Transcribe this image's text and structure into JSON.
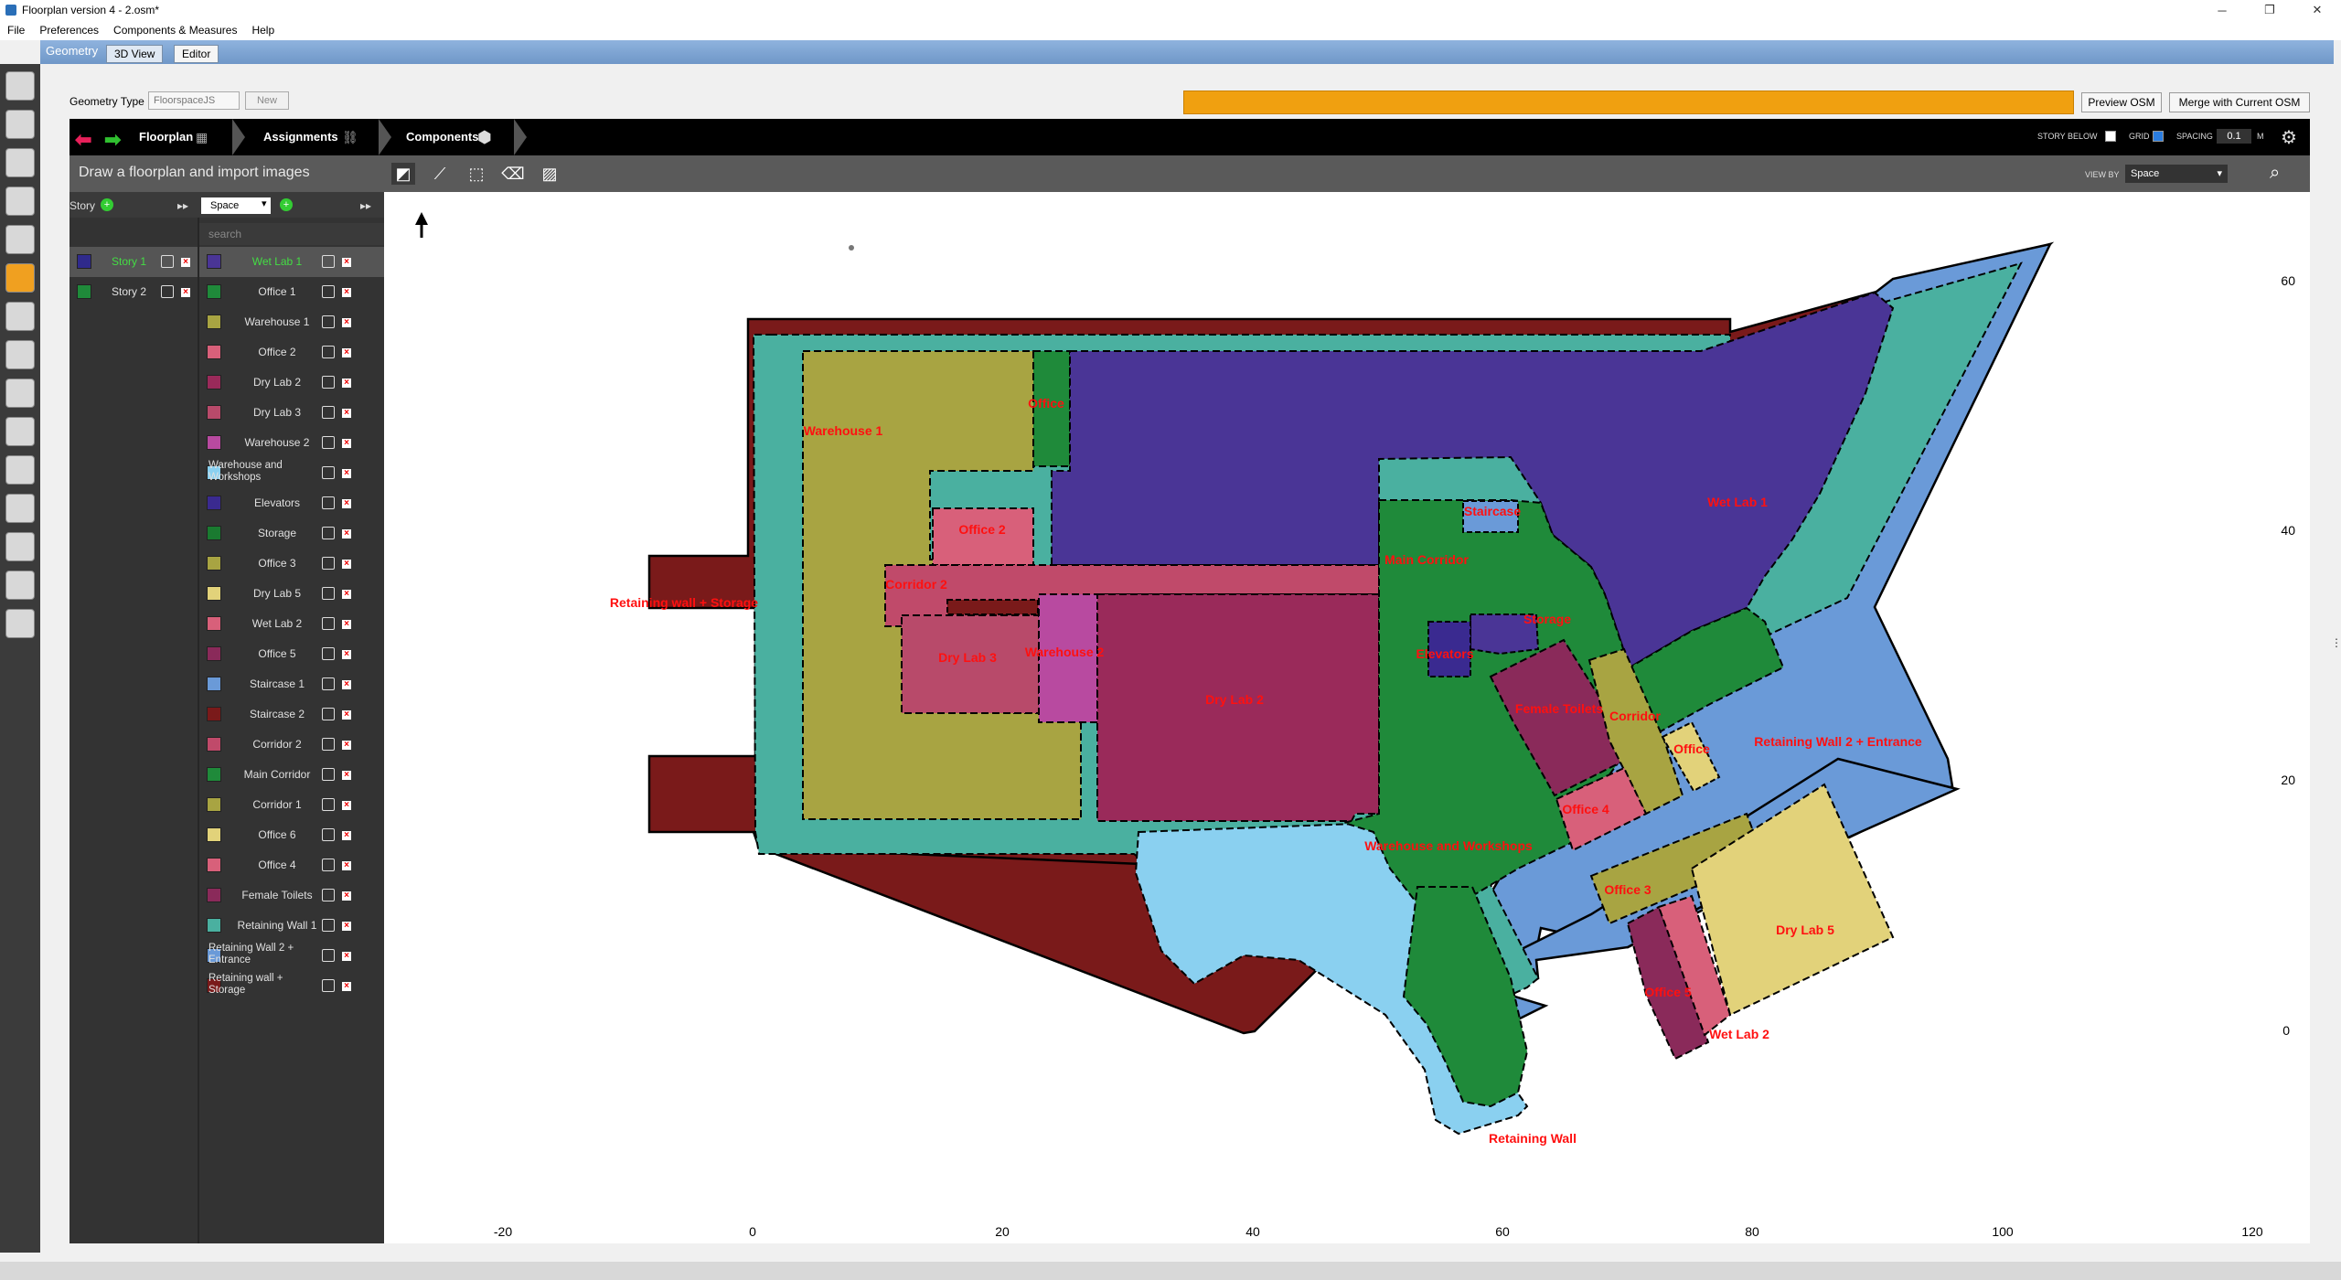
{
  "window": {
    "title": "Floorplan version 4 - 2.osm*",
    "min": "─",
    "max": "❐",
    "close": "✕"
  },
  "menu": [
    "File",
    "Preferences",
    "Components & Measures",
    "Help"
  ],
  "tabs": {
    "group": "Geometry",
    "view3d": "3D View",
    "editor": "Editor"
  },
  "geometry_type": {
    "label": "Geometry Type",
    "value": "FloorspaceJS",
    "new": "New"
  },
  "buttons": {
    "preview": "Preview OSM",
    "merge": "Merge with Current OSM"
  },
  "nav": {
    "floorplan": "Floorplan",
    "assignments": "Assignments",
    "components": "Components",
    "story_below": "STORY BELOW",
    "grid": "GRID",
    "spacing": "SPACING",
    "spacing_value": "0.1",
    "unit": "M"
  },
  "toolbar": {
    "header": "Draw a floorplan and import images",
    "view_by_label": "VIEW BY",
    "view_by_value": "Space"
  },
  "panel": {
    "story_label": "Story",
    "space_select": "Space",
    "search_placeholder": "search"
  },
  "stories": [
    {
      "name": "Story 1",
      "color": "#2f2a8c",
      "selected": true
    },
    {
      "name": "Story 2",
      "color": "#1f8a3a",
      "selected": false
    }
  ],
  "spaces": [
    {
      "name": "Wet Lab 1",
      "color": "#4a3596",
      "selected": true
    },
    {
      "name": "Office 1",
      "color": "#1f8a3a"
    },
    {
      "name": "Warehouse 1",
      "color": "#a8a442"
    },
    {
      "name": "Office 2",
      "color": "#d8607a"
    },
    {
      "name": "Dry Lab 2",
      "color": "#9a2a5a"
    },
    {
      "name": "Dry Lab 3",
      "color": "#b84a6a"
    },
    {
      "name": "Warehouse 2",
      "color": "#b84aa0"
    },
    {
      "name": "Warehouse and Workshops",
      "color": "#8ad0f0"
    },
    {
      "name": "Elevators",
      "color": "#3a2a90"
    },
    {
      "name": "Storage",
      "color": "#1a7a30"
    },
    {
      "name": "Office 3",
      "color": "#a8a442"
    },
    {
      "name": "Dry Lab 5",
      "color": "#e2d27a"
    },
    {
      "name": "Wet Lab 2",
      "color": "#d8607a"
    },
    {
      "name": "Office 5",
      "color": "#8a2a5a"
    },
    {
      "name": "Staircase 1",
      "color": "#6a9ad8"
    },
    {
      "name": "Staircase 2",
      "color": "#7a1a1a"
    },
    {
      "name": "Corridor 2",
      "color": "#c04a6a"
    },
    {
      "name": "Main Corridor",
      "color": "#1f8a3a"
    },
    {
      "name": "Corridor 1",
      "color": "#a8a442"
    },
    {
      "name": "Office 6",
      "color": "#e2d27a"
    },
    {
      "name": "Office 4",
      "color": "#d8607a"
    },
    {
      "name": "Female Toilets",
      "color": "#8a2a5a"
    },
    {
      "name": "Retaining Wall 1",
      "color": "#4ab0a0"
    },
    {
      "name": "Retaining Wall 2 + Entrance",
      "color": "#6a9ad8"
    },
    {
      "name": "Retaining wall + Storage",
      "color": "#7a1a1a"
    }
  ],
  "plan_labels": {
    "warehouse1": "Warehouse 1",
    "office": "Office",
    "office2": "Office 2",
    "corridor2": "Corridor 2",
    "drylab3": "Dry Lab 3",
    "warehouse2": "Warehouse 2",
    "drylab2": "Dry Lab 2",
    "retstorage": "Retaining wall + Storage",
    "staircase": "Staircase",
    "maincorr": "Main Corridor",
    "wetlab1": "Wet Lab 1",
    "storage": "Storage",
    "elevators": "Elevators",
    "femaletoilets": "Female Toilets",
    "corridor": "Corridor",
    "office6": "Office",
    "ret2": "Retaining Wall 2 + Entrance",
    "office4": "Office 4",
    "wh_workshops": "Warehouse and Workshops",
    "office3": "Office 3",
    "drylab5": "Dry Lab 5",
    "office5": "Office 5",
    "wetlab2": "Wet Lab 2",
    "retwall": "Retaining Wall",
    "staircase2": "Staircase 2"
  },
  "x_axis": [
    "-20",
    "0",
    "20",
    "40",
    "60",
    "80",
    "100",
    "120"
  ],
  "y_axis": [
    "60",
    "40",
    "20",
    "0"
  ]
}
